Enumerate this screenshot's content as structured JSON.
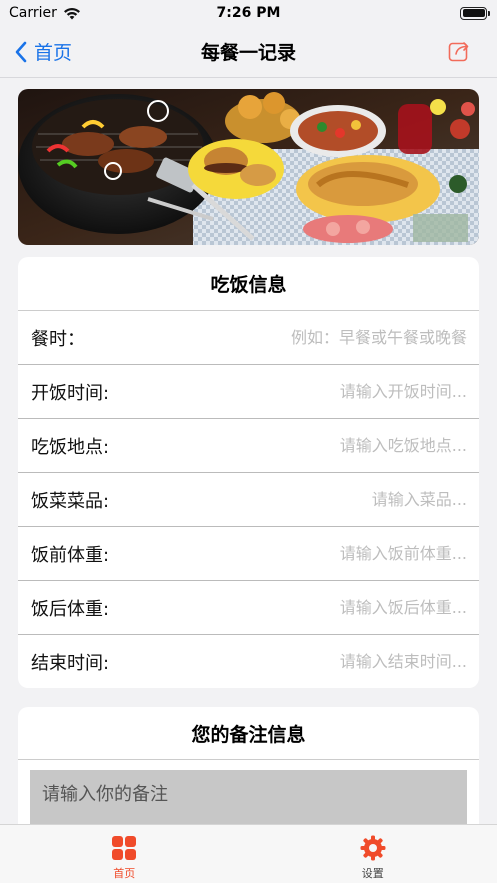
{
  "status_bar": {
    "carrier": "Carrier",
    "time": "7:26 PM"
  },
  "nav": {
    "back_label": "首页",
    "title": "每餐一记录"
  },
  "colors": {
    "accent": "#1a73e8",
    "brand": "#f04b2a"
  },
  "meal_info": {
    "title": "吃饭信息",
    "fields": [
      {
        "label": "餐时：",
        "placeholder": "例如：早餐或午餐或晚餐"
      },
      {
        "label": "开饭时间:",
        "placeholder": "请输入开饭时间..."
      },
      {
        "label": "吃饭地点:",
        "placeholder": "请输入吃饭地点..."
      },
      {
        "label": "饭菜菜品:",
        "placeholder": "请输入菜品..."
      },
      {
        "label": "饭前体重:",
        "placeholder": "请输入饭前体重..."
      },
      {
        "label": "饭后体重:",
        "placeholder": "请输入饭后体重..."
      },
      {
        "label": "结束时间:",
        "placeholder": "请输入结束时间..."
      }
    ]
  },
  "notes": {
    "title": "您的备注信息",
    "placeholder": "请输入你的备注"
  },
  "tabs": [
    {
      "label": "首页",
      "icon": "grid-icon",
      "active": true
    },
    {
      "label": "设置",
      "icon": "gear-icon",
      "active": false
    }
  ]
}
